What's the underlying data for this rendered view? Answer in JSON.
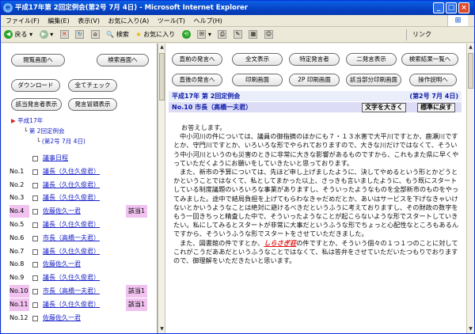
{
  "window": {
    "title": "平成17年第 2回定例会(第2号 7月 4日) - Microsoft Internet Explorer",
    "buttons": [
      "_",
      "□",
      "×"
    ]
  },
  "menu": [
    "ファイル(F)",
    "編集(E)",
    "表示(V)",
    "お気に入り(A)",
    "ツール(T)",
    "ヘルプ(H)"
  ],
  "toolbar": {
    "back": "戻る",
    "search": "検索",
    "favorites": "お気に入り",
    "link": "リンク"
  },
  "left": {
    "btn_meeting": "閲覧画面へ",
    "btn_search": "検索画面へ",
    "btn_download": "ダウンロード",
    "btn_check_all": "全てチェック",
    "btn_speaker_list": "該当発言者表示",
    "btn_speaker_excerpt": "発言冒頭表示",
    "tree_year": "平成17年",
    "tree_session": "第 2回定例会",
    "tree_day": "(第2号 7月 4日)",
    "rows": [
      {
        "no": "",
        "label": "議事日程",
        "tag": ""
      },
      {
        "no": "No.1",
        "label": "議長（久住久俊君）",
        "tag": ""
      },
      {
        "no": "No.2",
        "label": "議長（久住久俊君）",
        "tag": ""
      },
      {
        "no": "No.3",
        "label": "議長（久住久俊君）",
        "tag": ""
      },
      {
        "no": "No.4",
        "label": "佐藤佐久一君",
        "tag": "該当1"
      },
      {
        "no": "No.5",
        "label": "議長（久住久俊君）",
        "tag": ""
      },
      {
        "no": "No.6",
        "label": "市長（高橋一夫君）",
        "tag": ""
      },
      {
        "no": "No.7",
        "label": "議長（久住久俊君）",
        "tag": ""
      },
      {
        "no": "No.8",
        "label": "佐藤佐久一君",
        "tag": ""
      },
      {
        "no": "No.9",
        "label": "議長（久住久俊君）",
        "tag": ""
      },
      {
        "no": "No.10",
        "label": "市長（高橋一夫君）",
        "tag": "該当1"
      },
      {
        "no": "No.11",
        "label": "議長（久住久俊君）",
        "tag": "該当1"
      },
      {
        "no": "No.12",
        "label": "佐藤佐久一君",
        "tag": ""
      }
    ]
  },
  "right": {
    "buttons_row1": [
      "直前の発言へ",
      "全文表示",
      "特定発言者",
      "二発言表示",
      "検索結果一覧へ"
    ],
    "buttons_row2": [
      "直後の発言へ",
      "印刷画面",
      "2P 印刷画面",
      "該当部分印刷画面",
      "操作説明へ"
    ],
    "header_title": "平成17年 第 2回定例会",
    "header_date": "(第2号 7月 4日)",
    "speaker": "No.10 市長（高橋一夫君）",
    "btn_bigger": "文字を大きく",
    "btn_reset": "標準に戻す",
    "paragraphs": [
      "お答えします。",
      "中小河川の件については、議員の御指摘のほかにも７・１３水害で大平川ですとか、鹿瀬川ですとか、守門川ですとか、いろいろな形でやられておりますので、大きな川だけではなくて、そういう中小河川というのも災害のときに非常に大きな影響があるものですから、これもまた県に早くやっていただくようにお願いをしていきたいと思っております。",
      "また、新市の予算については、先ほど申し上げましたように、決してやめるという形とかどうとかということではなくて、私としてまかった以上、さっきも言いましたように、もう既にスタートしている制度議題のいろいろな事業がありますし、そういったようなものを全部新市のものをやってみました。途中で結局負担を上げてもらわなきゃだめだとか、あいはサービスを下げなきゃいけないとかいうようなことは絶対に避けるべきだというふうに考えておりますし、その財政の数字をもう一回きちっと精査した中で、そういったようなことが起こらないような形でスタートしていきたい。私にしてみるとスタートが非常に大事だというふうな形でちょっと心配性なところもあるんですから、そういうふうな形でスタートをさせていただきました。",
      "",
      "、そういう個々の１つ１つのことに対してこれがこうだああだというふうなことではなくて、私は答弁をさせていただいたつもりでおりますので、御理解をいただきたいと思います。"
    ],
    "para4_pre": "また、図書館の件ですとか、",
    "para4_emph": "しらさぎ荘",
    "para4_post": "の件ですとか"
  }
}
